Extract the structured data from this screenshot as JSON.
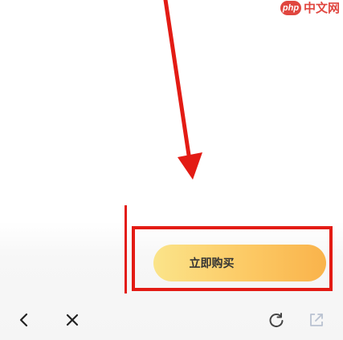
{
  "watermark": {
    "badge_text": "php",
    "site_text": "中文网",
    "color": "#e0463f"
  },
  "purchase": {
    "buy_label": "立即购买",
    "button_gradient": [
      "#fbe48a",
      "#fcc964",
      "#f9b34b"
    ]
  },
  "annotation": {
    "color": "#e31b14"
  },
  "nav": {
    "icons": [
      "chevron-left-icon",
      "close-icon",
      "refresh-icon",
      "share-icon"
    ]
  }
}
